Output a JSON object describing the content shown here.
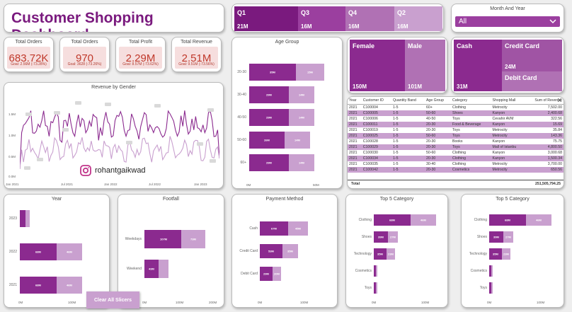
{
  "title": "Customer Shopping Dashboard",
  "kpis": [
    {
      "label": "Total Orders",
      "value": "683.72K",
      "goal": "Goal: 2.56M (-73.28%)"
    },
    {
      "label": "Total Orders",
      "value": "970",
      "goal": "Goal: 3628 (-73.26%)"
    },
    {
      "label": "Total Profit",
      "value": "2.29M",
      "goal": "Goal: 8.57M (-73.62%)"
    },
    {
      "label": "Total Revenue",
      "value": "2.51M",
      "goal": "Goal: 9.51M (-73.56%)"
    }
  ],
  "quarters": [
    {
      "name": "Q1",
      "value": "21M"
    },
    {
      "name": "Q3",
      "value": "16M"
    },
    {
      "name": "Q4",
      "value": "16M"
    },
    {
      "name": "Q2",
      "value": "16M"
    }
  ],
  "slicer": {
    "label": "Month And Year",
    "value": "All"
  },
  "gender": [
    {
      "name": "Female",
      "value": "150M"
    },
    {
      "name": "Male",
      "value": "101M"
    }
  ],
  "payment_tiles": [
    {
      "name": "Cash",
      "value": "31M"
    },
    {
      "name": "Credit Card",
      "value": "24M"
    },
    {
      "name": "Debit Card",
      "value": ""
    }
  ],
  "revenue_chart": {
    "title": "Revenue by Gender",
    "yticks": [
      "1.5M",
      "1.0M",
      "0.5M",
      "0.0M"
    ],
    "xticks": [
      "Jan 2021",
      "Jul 2021",
      "Jan 2022",
      "Jul 2022",
      "Jan 2023"
    ],
    "watermark": "rohantgaikwad"
  },
  "age_group": {
    "title": "Age Group",
    "rows": [
      {
        "label": "20-30",
        "a": "35M",
        "b": "15M"
      },
      {
        "label": "30-40",
        "a": "29M",
        "b": "14M"
      },
      {
        "label": "40-50",
        "a": "29M",
        "b": "14M"
      },
      {
        "label": "50-60",
        "a": "26M",
        "b": "14M"
      },
      {
        "label": "60+",
        "a": "29M",
        "b": "14M"
      }
    ],
    "axis": [
      "0M",
      "50M"
    ]
  },
  "table": {
    "headers": [
      "Year",
      "Customer ID",
      "Quantity Band",
      "Age Group",
      "Category",
      "Shopping Mall",
      "Sum of Revenue"
    ],
    "rows": [
      [
        "2021",
        "C100004",
        "1-5",
        "60+",
        "Clothing",
        "Metrocity",
        "7,502.00"
      ],
      [
        "2021",
        "C100005",
        "1-5",
        "50-60",
        "Shoes",
        "Kanyon",
        "2,400.68"
      ],
      [
        "2021",
        "C100006",
        "1-5",
        "40-50",
        "Toys",
        "Cevahir AVM",
        "322.56"
      ],
      [
        "2021",
        "C100011",
        "1-5",
        "20-30",
        "Food & Beverage",
        "Kanyon",
        "15.69"
      ],
      [
        "2021",
        "C100019",
        "1-5",
        "20-30",
        "Toys",
        "Metrocity",
        "35.84"
      ],
      [
        "2021",
        "C100025",
        "1-5",
        "50-60",
        "Toys",
        "Metrocity",
        "143.36"
      ],
      [
        "2021",
        "C100028",
        "1-5",
        "20-30",
        "Books",
        "Kanyon",
        "75.75"
      ],
      [
        "2021",
        "C100029",
        "1-5",
        "20-30",
        "Toys",
        "Mall of Istanbu",
        "4,800.50"
      ],
      [
        "2021",
        "C100030",
        "1-5",
        "50-60",
        "Clothing",
        "Kanyon",
        "3,000.68"
      ],
      [
        "2021",
        "C100034",
        "1-5",
        "20-30",
        "Clothing",
        "Kanyon",
        "1,500.34"
      ],
      [
        "2021",
        "C100035",
        "1-5",
        "30-40",
        "Clothing",
        "Metrocity",
        "3,700.00"
      ],
      [
        "2021",
        "C100042",
        "1-5",
        "20-30",
        "Cosmetics",
        "Metrocity",
        "650.56"
      ]
    ],
    "total_label": "Total",
    "total_value": "251,505,794.25"
  },
  "year_chart": {
    "title": "Year",
    "rows": [
      {
        "label": "2023",
        "a": "",
        "b": ""
      },
      {
        "label": "2022",
        "a": "68M",
        "b": "46M"
      },
      {
        "label": "2021",
        "a": "68M",
        "b": "46M"
      }
    ],
    "axis": [
      "0M",
      "100M"
    ]
  },
  "footfall": {
    "title": "Footfall",
    "rows": [
      {
        "label": "Weekdays",
        "a": "107M",
        "b": "73M"
      },
      {
        "label": "Weekend",
        "a": "43M",
        "b": ""
      }
    ],
    "axis": [
      "0M",
      "100M",
      "200M"
    ]
  },
  "payment_chart": {
    "title": "Payment Method",
    "rows": [
      {
        "label": "Cash",
        "a": "67M",
        "b": "45M"
      },
      {
        "label": "Credit Card",
        "a": "53M",
        "b": "35M"
      },
      {
        "label": "Debit Card",
        "a": "29M",
        "b": "20M"
      }
    ],
    "axis": [
      "0M",
      "100M"
    ]
  },
  "top5_a": {
    "title": "Top 5 Category",
    "rows": [
      {
        "label": "Clothing",
        "a": "68M",
        "b": "46M"
      },
      {
        "label": "Shoes",
        "a": "39M",
        "b": "27M"
      },
      {
        "label": "Technology",
        "a": "35M",
        "b": "23M"
      },
      {
        "label": "Cosmetics",
        "a": "",
        "b": ""
      },
      {
        "label": "Toys",
        "a": "",
        "b": ""
      }
    ],
    "axis": [
      "0M",
      "100M"
    ]
  },
  "top5_b": {
    "title": "Top 5 Category",
    "rows": [
      {
        "label": "Clothing",
        "a": "68M",
        "b": "46M"
      },
      {
        "label": "Shoes",
        "a": "39M",
        "b": "27M"
      },
      {
        "label": "Technology",
        "a": "35M",
        "b": "23M"
      },
      {
        "label": "Cosmetics",
        "a": "",
        "b": ""
      },
      {
        "label": "Toys",
        "a": "",
        "b": ""
      }
    ],
    "axis": [
      "0M",
      "100M"
    ]
  },
  "clear_button": "Clear All Slicers",
  "colors": {
    "dark": "#8b2a8f",
    "light": "#c9a0cf",
    "title": "#7a1a7e",
    "kpi_bg": "#f6dede",
    "kpi_text": "#c0392b"
  }
}
